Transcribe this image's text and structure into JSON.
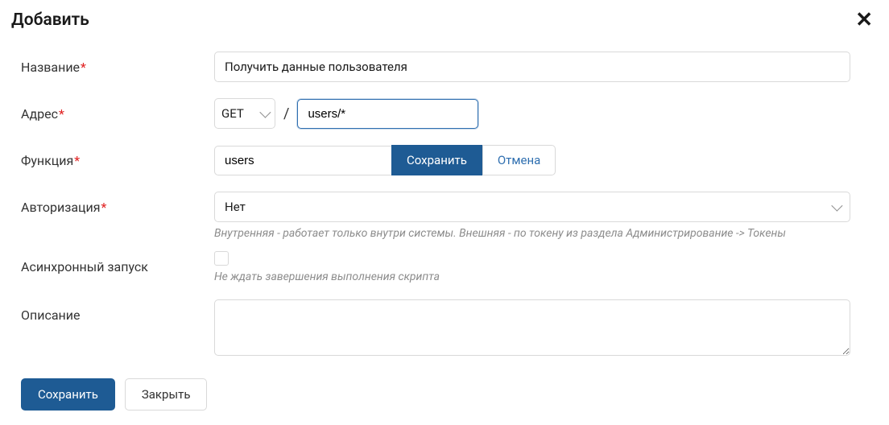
{
  "header": {
    "title": "Добавить"
  },
  "labels": {
    "name": "Название",
    "address": "Адрес",
    "function": "Функция",
    "auth": "Авторизация",
    "async": "Асинхронный запуск",
    "description": "Описание"
  },
  "values": {
    "name": "Получить данные пользователя",
    "method": "GET",
    "path": "users/*",
    "function": "users",
    "auth": "Нет",
    "async": false,
    "description": ""
  },
  "hints": {
    "auth": "Внутренняя - работает только внутри системы. Внешняя - по токену из раздела Администрирование -> Токены",
    "async": "Не ждать завершения выполнения скрипта"
  },
  "buttons": {
    "inner_save": "Сохранить",
    "inner_cancel": "Отмена",
    "save": "Сохранить",
    "close": "Закрыть"
  }
}
